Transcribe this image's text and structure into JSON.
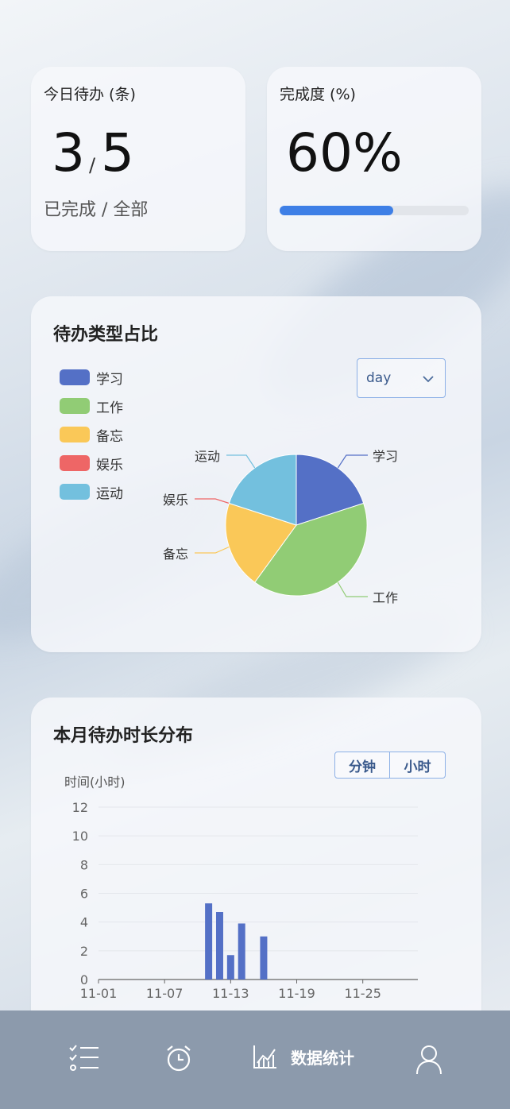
{
  "stats": {
    "today": {
      "title": "今日待办 (条)",
      "done": "3",
      "separator": "/",
      "total": "5",
      "sublabel": "已完成 / 全部"
    },
    "completion": {
      "title": "完成度 (%)",
      "value": "60%",
      "progress": 0.6
    }
  },
  "type_card": {
    "title": "待办类型占比",
    "range_select": {
      "selected": "day"
    },
    "legend": [
      {
        "label": "学习",
        "color": "#5470c6"
      },
      {
        "label": "工作",
        "color": "#91cc75"
      },
      {
        "label": "备忘",
        "color": "#fac858"
      },
      {
        "label": "娱乐",
        "color": "#ee6666"
      },
      {
        "label": "运动",
        "color": "#73c0de"
      }
    ]
  },
  "duration_card": {
    "title": "本月待办时长分布",
    "units": [
      "分钟",
      "小时"
    ]
  },
  "tabbar": {
    "items": [
      {
        "id": "todo-list",
        "label": ""
      },
      {
        "id": "alarm",
        "label": ""
      },
      {
        "id": "stats",
        "label": "数据统计"
      },
      {
        "id": "profile",
        "label": ""
      }
    ]
  },
  "chart_data": [
    {
      "type": "pie",
      "labels": [
        "学习",
        "工作",
        "备忘",
        "娱乐",
        "运动"
      ],
      "values": [
        20,
        40,
        20,
        0,
        20
      ],
      "colors": [
        "#5470c6",
        "#91cc75",
        "#fac858",
        "#ee6666",
        "#73c0de"
      ]
    },
    {
      "type": "bar",
      "ylabel": "时间(小时)",
      "x_ticks": [
        "11-01",
        "11-07",
        "11-13",
        "11-19",
        "11-25"
      ],
      "y_ticks": [
        0,
        2,
        4,
        6,
        8,
        10,
        12
      ],
      "ylim": [
        0,
        12
      ],
      "x_days": [
        11,
        12,
        13,
        14,
        16
      ],
      "x": [
        "11-11",
        "11-12",
        "11-13",
        "11-14",
        "11-16"
      ],
      "values": [
        5.3,
        4.7,
        1.7,
        3.9,
        3.0
      ],
      "color": "#5470c6",
      "grid": true
    }
  ]
}
